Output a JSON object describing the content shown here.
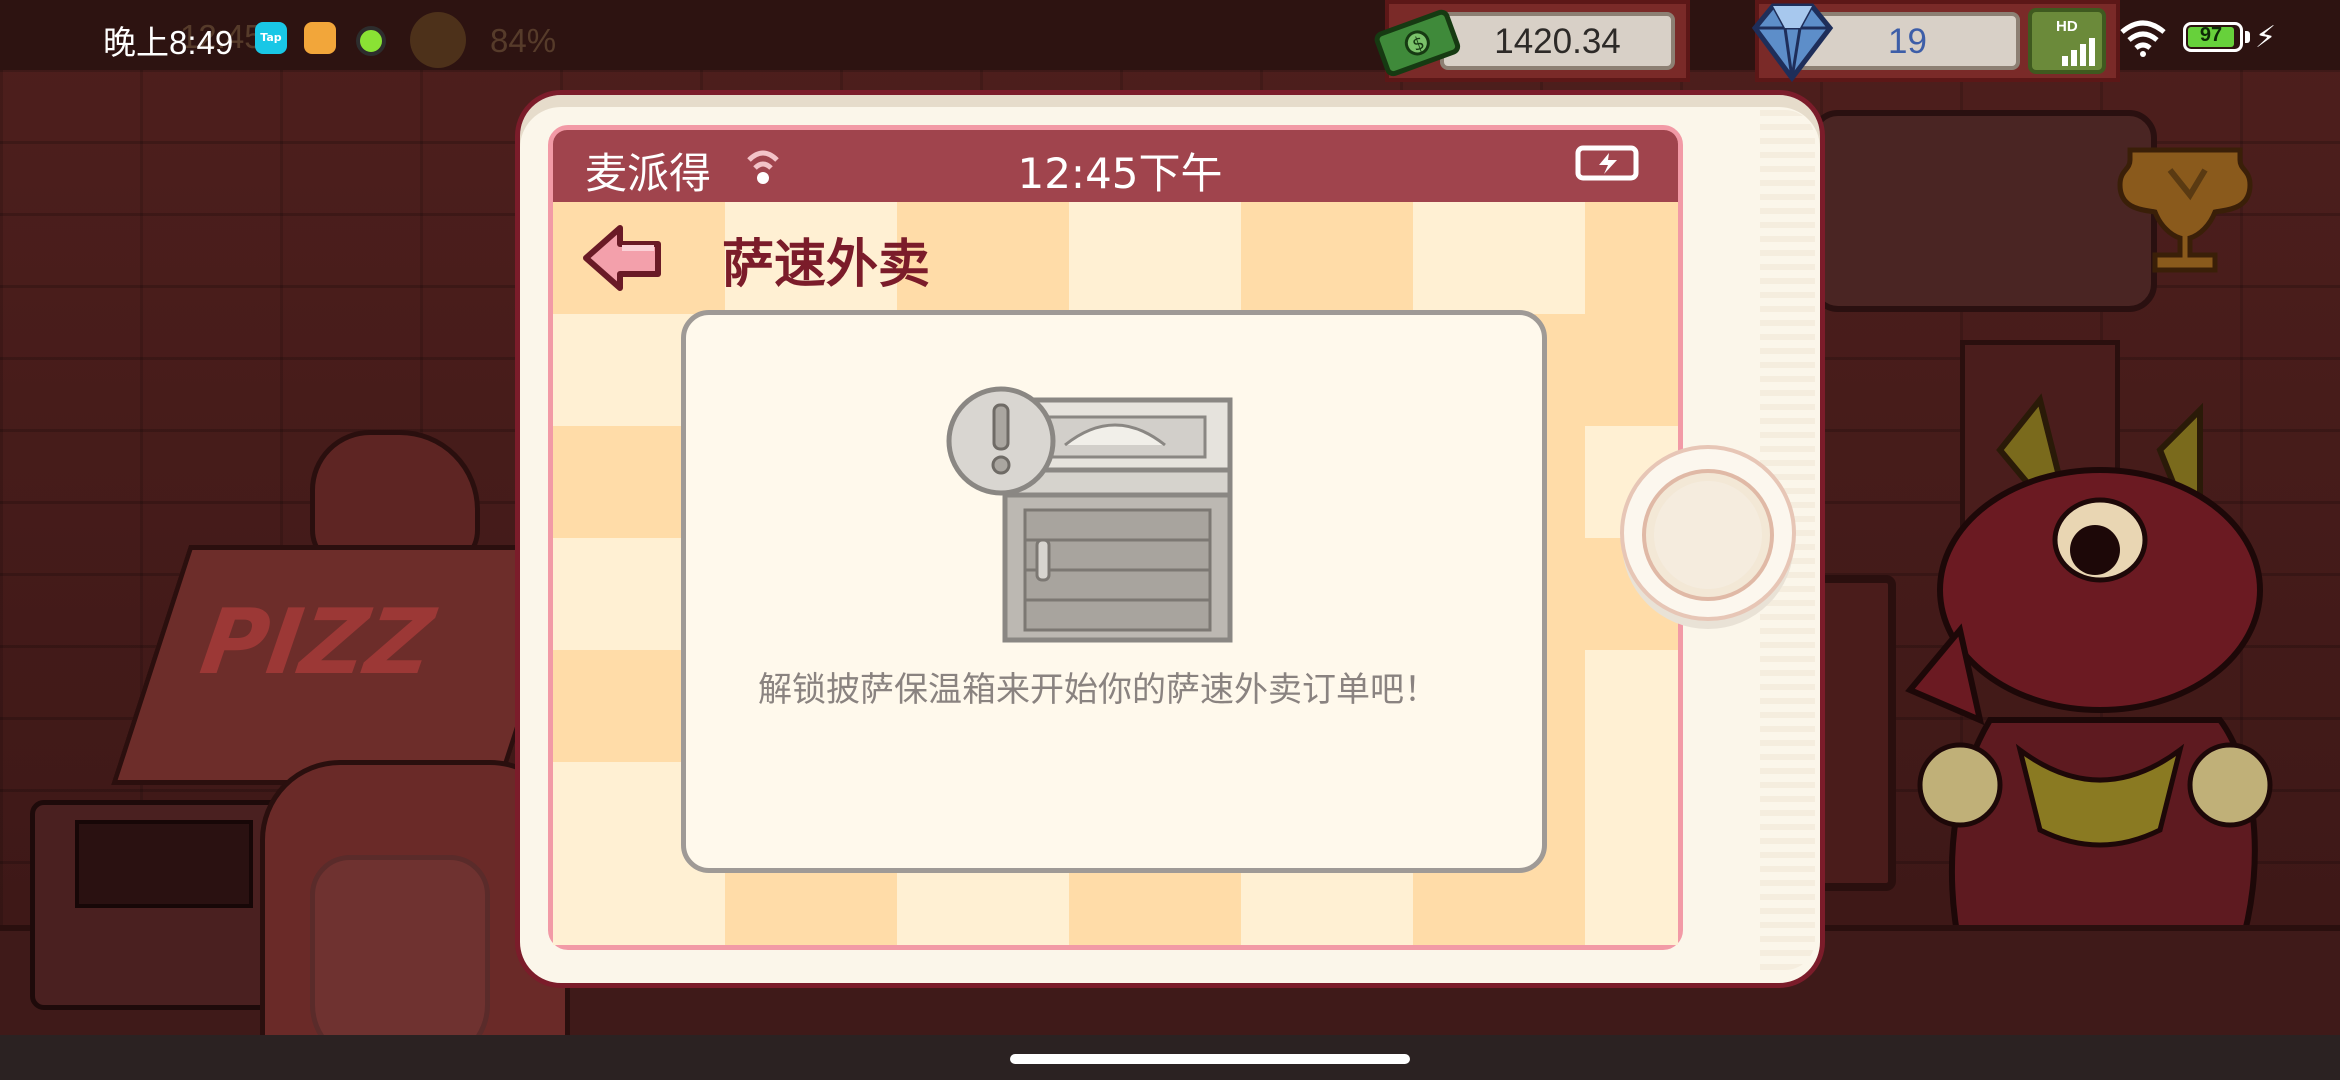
{
  "status_bar": {
    "time": "晚上8:49",
    "tap_app_label": "Tap",
    "battery": "97",
    "faint_overlay_time": "12:45",
    "faint_overlay_battery": "84%"
  },
  "currency": {
    "money": "1420.34",
    "gems": "19",
    "hd_label": "HD"
  },
  "phone": {
    "carrier": "麦派得",
    "clock": "12:45下午",
    "title": "萨速外卖",
    "message": "解锁披萨保温箱来开始你的萨速外卖订单吧！"
  },
  "colors": {
    "header_bar": "#a0444d",
    "title_text": "#7b1c2a",
    "back_arrow": "#f3a0ab",
    "checker_light": "#fff0d3",
    "checker_dark": "#ffdca8"
  }
}
